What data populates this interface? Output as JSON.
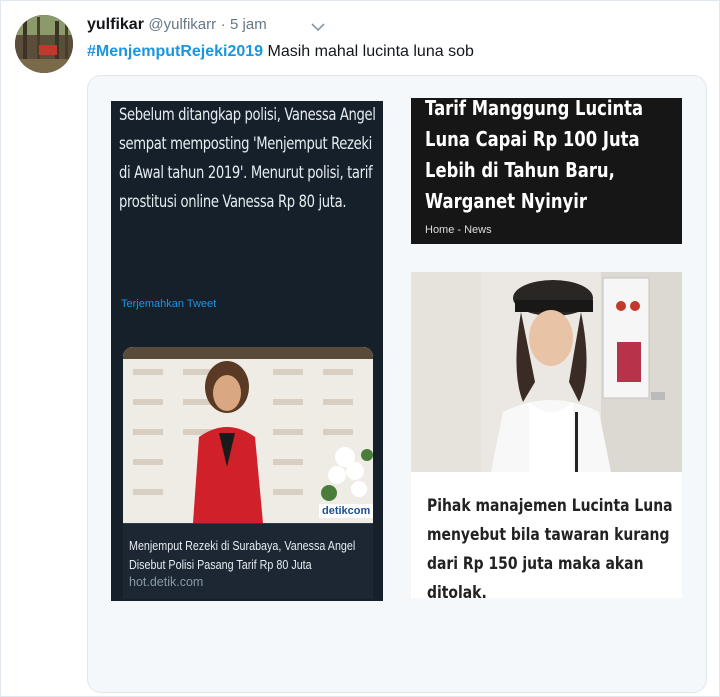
{
  "tweet": {
    "name": "yulfikar",
    "handle": "@yulfikarr",
    "separator": "·",
    "time": "5 jam",
    "hashtag": "#MenjemputRejeki2019",
    "text": " Masih mahal lucinta luna sob"
  },
  "left_screenshot": {
    "body": "Sebelum ditangkap polisi, Vanessa Angel sempat memposting 'Menjemput Rezeki di Awal tahun 2019'. Menurut polisi, tarif prostitusi online Vanessa Rp 80 juta.",
    "translate_link": "Terjemahkan Tweet",
    "photo_watermark": "detikcom",
    "card_title": "Menjemput Rezeki di Surabaya, Vanessa Angel Disebut Polisi Pasang Tarif Rp 80 Juta",
    "card_link": "hot.detik.com"
  },
  "right_screenshot": {
    "headline": "Tarif Manggung Lucinta Luna Capai Rp 100 Juta Lebih di Tahun Baru, Warganet Nyinyir",
    "breadcrumb": "Home - News",
    "body": "Pihak manajemen Lucinta Luna menyebut bila tawaran kurang dari Rp 150 juta maka akan ditolak."
  },
  "colors": {
    "link": "#1b95e0",
    "dark_bg": "#15202b",
    "muted": "#657786"
  },
  "icons": {
    "caret": "chevron-down-icon"
  }
}
